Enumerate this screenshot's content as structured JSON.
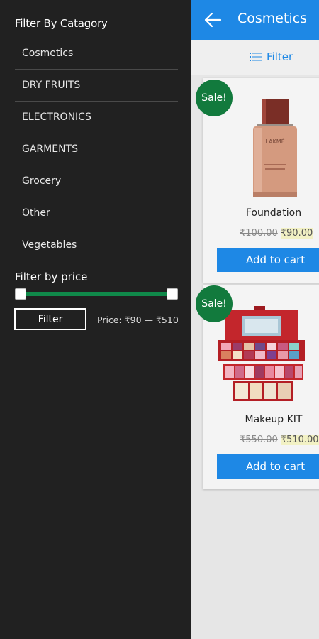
{
  "drawer": {
    "title": "Filter By Catagory",
    "categories": [
      "Cosmetics",
      "DRY FRUITS",
      "ELECTRONICS",
      "GARMENTS",
      "Grocery",
      "Other",
      "Vegetables"
    ],
    "price_title": "Filter by price",
    "price_slider": {
      "min": 90,
      "max": 510
    },
    "filter_button": "Filter",
    "price_range_text": "Price: ₹90 — ₹510"
  },
  "appbar": {
    "title": "Cosmetics",
    "back_icon": "arrow-left-icon"
  },
  "filterbar": {
    "label": "Filter",
    "icon": "list-filter-icon"
  },
  "products": [
    {
      "sale_label": "Sale!",
      "name": "Foundation",
      "old_price": "₹100.00",
      "new_price": "₹90.00",
      "cart_label": "Add to cart"
    },
    {
      "sale_label": "Sale!",
      "name": "Makeup KIT",
      "old_price": "₹550.00",
      "new_price": "₹510.00",
      "cart_label": "Add to cart"
    }
  ],
  "colors": {
    "drawer_bg": "#212121",
    "accent": "#1e88e5",
    "sale": "#127a3d",
    "slider": "#10894a"
  }
}
